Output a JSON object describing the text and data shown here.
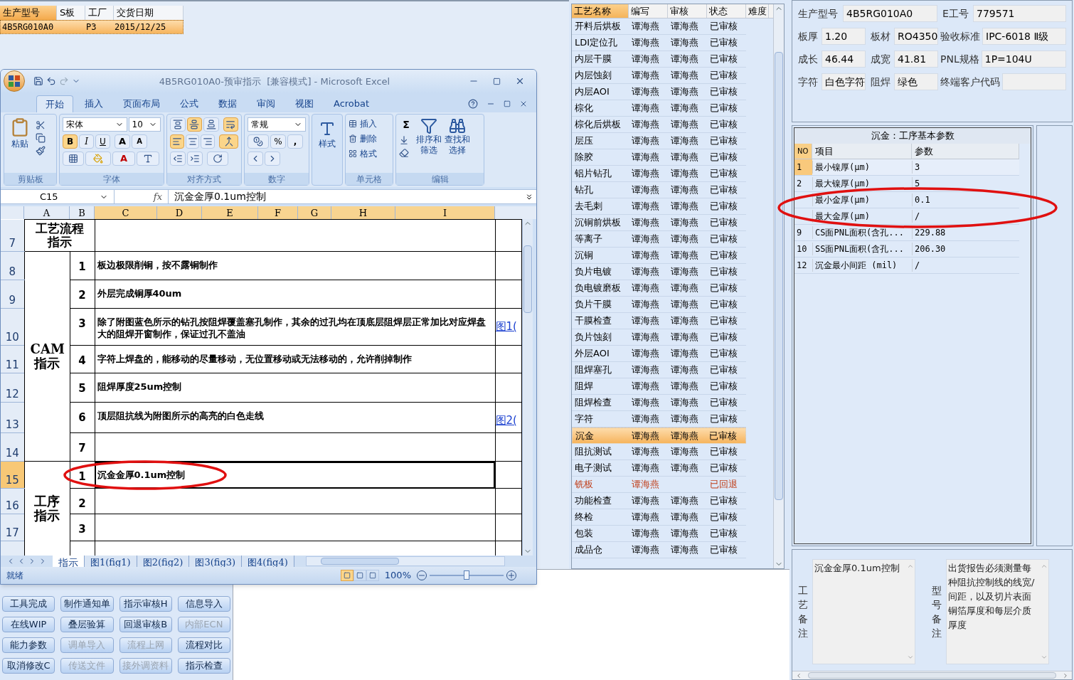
{
  "order_table": {
    "columns": [
      {
        "label": "生产型号",
        "selected": true
      },
      {
        "label": "S板",
        "selected": false
      },
      {
        "label": "工厂",
        "selected": false
      },
      {
        "label": "交货日期",
        "selected": false
      }
    ],
    "rows": [
      {
        "model": "4B5RG010A0",
        "factory": "P3",
        "delivery_date": "2015/12/25",
        "selected": true
      }
    ]
  },
  "excel": {
    "title": "4B5RG010A0-预审指示  [兼容模式] - Microsoft Excel",
    "tabs": [
      {
        "label": "开始",
        "selected": true
      },
      {
        "label": "插入",
        "selected": false
      },
      {
        "label": "页面布局",
        "selected": false
      },
      {
        "label": "公式",
        "selected": false
      },
      {
        "label": "数据",
        "selected": false
      },
      {
        "label": "审阅",
        "selected": false
      },
      {
        "label": "视图",
        "selected": false
      },
      {
        "label": "Acrobat",
        "selected": false
      }
    ],
    "ribbon": {
      "paste": "粘贴",
      "font_name": "宋体",
      "font_size": "10",
      "format_buttons": [
        {
          "label": "B",
          "on": true
        },
        {
          "label": "I",
          "on": false
        },
        {
          "label": "U",
          "on": false
        }
      ],
      "grow_font": "A",
      "shrink_font": "A",
      "font_color": "A",
      "vertical_align": [
        {
          "on": false
        },
        {
          "on": true
        },
        {
          "on": false
        }
      ],
      "horizontal_align": [
        {
          "on": true
        },
        {
          "on": false
        },
        {
          "on": false
        }
      ],
      "wrap_text": {
        "on": true
      },
      "merge": {
        "on": true
      },
      "number_format": "常规",
      "percent": "%",
      "comma": ",",
      "styles": "样式",
      "cell_buttons": [
        "插入",
        "删除",
        "格式"
      ],
      "sum": "Σ",
      "sort_filter": [
        "排序和",
        "筛选"
      ],
      "find_select": [
        "查找和",
        "选择"
      ],
      "group_labels": [
        "剪贴板",
        "字体",
        "对齐方式",
        "数字",
        "单元格",
        "编辑"
      ]
    },
    "name_box": "C15",
    "formula_label": "fx",
    "formula": "沉金金厚0.1um控制",
    "columns": [
      {
        "label": "A",
        "selected": false
      },
      {
        "label": "B",
        "selected": false
      },
      {
        "label": "C",
        "selected": true
      },
      {
        "label": "D",
        "selected": true
      },
      {
        "label": "E",
        "selected": true
      },
      {
        "label": "F",
        "selected": true
      },
      {
        "label": "G",
        "selected": true
      },
      {
        "label": "H",
        "selected": true
      },
      {
        "label": "I",
        "selected": true
      }
    ],
    "row_numbers": [
      {
        "label": "7",
        "selected": false
      },
      {
        "label": "8",
        "selected": false
      },
      {
        "label": "9",
        "selected": false
      },
      {
        "label": "10",
        "selected": false
      },
      {
        "label": "11",
        "selected": false
      },
      {
        "label": "12",
        "selected": false
      },
      {
        "label": "13",
        "selected": false
      },
      {
        "label": "14",
        "selected": false
      },
      {
        "label": "15",
        "selected": true
      },
      {
        "label": "16",
        "selected": false
      },
      {
        "label": "17",
        "selected": false
      }
    ],
    "title_cell": "工艺流程指示",
    "sections": [
      {
        "label": "CAM\n指示",
        "items": [
          {
            "no": "1",
            "text": "板边极限削铜，按不露铜制作"
          },
          {
            "no": "2",
            "text": "外层完成铜厚40um"
          },
          {
            "no": "3",
            "text": "除了附图蓝色所示的钻孔按阻焊覆盖塞孔制作，其余的过孔均在顶底层阻焊层正常加比对应焊盘大的阻焊开窗制作，保证过孔不盖油",
            "link": "图1("
          },
          {
            "no": "4",
            "text": "字符上焊盘的，能移动的尽量移动，无位置移动或无法移动的，允许削掉制作"
          },
          {
            "no": "5",
            "text": "阻焊厚度25um控制"
          },
          {
            "no": "6",
            "text": "顶层阻抗线为附图所示的高亮的白色走线",
            "link": "图2("
          },
          {
            "no": "7"
          }
        ]
      },
      {
        "label": "工序指示",
        "items": [
          {
            "no": "1",
            "text": "沉金金厚0.1um控制",
            "selected": true
          },
          {
            "no": "2"
          },
          {
            "no": "3"
          }
        ]
      }
    ],
    "sheet_tabs": [
      {
        "label": "指示",
        "selected": true
      },
      {
        "label": "图1(fig1)",
        "selected": false
      },
      {
        "label": "图2(fig2)",
        "selected": false
      },
      {
        "label": "图3(fig3)",
        "selected": false
      },
      {
        "label": "图4(fig4)",
        "selected": false
      }
    ],
    "status": "就绪",
    "views": [
      {
        "selected": true
      },
      {
        "selected": false
      },
      {
        "selected": false
      }
    ],
    "zoom": "100%",
    "zoom_slider": {
      "level": 0.5
    }
  },
  "process_list": {
    "columns": [
      "工艺名称",
      "编写",
      "审核",
      "状态",
      "难度"
    ],
    "rows": [
      {
        "name": "开料后烘板",
        "writer": "谭海燕",
        "reviewer": "谭海燕",
        "status": "已审核",
        "returned": false,
        "selected": false
      },
      {
        "name": "LDI定位孔",
        "writer": "谭海燕",
        "reviewer": "谭海燕",
        "status": "已审核",
        "returned": false,
        "selected": false
      },
      {
        "name": "内层干膜",
        "writer": "谭海燕",
        "reviewer": "谭海燕",
        "status": "已审核",
        "returned": false,
        "selected": false
      },
      {
        "name": "内层蚀刻",
        "writer": "谭海燕",
        "reviewer": "谭海燕",
        "status": "已审核",
        "returned": false,
        "selected": false
      },
      {
        "name": "内层AOI",
        "writer": "谭海燕",
        "reviewer": "谭海燕",
        "status": "已审核",
        "returned": false,
        "selected": false
      },
      {
        "name": "棕化",
        "writer": "谭海燕",
        "reviewer": "谭海燕",
        "status": "已审核",
        "returned": false,
        "selected": false
      },
      {
        "name": "棕化后烘板",
        "writer": "谭海燕",
        "reviewer": "谭海燕",
        "status": "已审核",
        "returned": false,
        "selected": false
      },
      {
        "name": "层压",
        "writer": "谭海燕",
        "reviewer": "谭海燕",
        "status": "已审核",
        "returned": false,
        "selected": false
      },
      {
        "name": "除胶",
        "writer": "谭海燕",
        "reviewer": "谭海燕",
        "status": "已审核",
        "returned": false,
        "selected": false
      },
      {
        "name": "铝片钻孔",
        "writer": "谭海燕",
        "reviewer": "谭海燕",
        "status": "已审核",
        "returned": false,
        "selected": false
      },
      {
        "name": "钻孔",
        "writer": "谭海燕",
        "reviewer": "谭海燕",
        "status": "已审核",
        "returned": false,
        "selected": false
      },
      {
        "name": "去毛刺",
        "writer": "谭海燕",
        "reviewer": "谭海燕",
        "status": "已审核",
        "returned": false,
        "selected": false
      },
      {
        "name": "沉铜前烘板",
        "writer": "谭海燕",
        "reviewer": "谭海燕",
        "status": "已审核",
        "returned": false,
        "selected": false
      },
      {
        "name": "等离子",
        "writer": "谭海燕",
        "reviewer": "谭海燕",
        "status": "已审核",
        "returned": false,
        "selected": false
      },
      {
        "name": "沉铜",
        "writer": "谭海燕",
        "reviewer": "谭海燕",
        "status": "已审核",
        "returned": false,
        "selected": false
      },
      {
        "name": "负片电镀",
        "writer": "谭海燕",
        "reviewer": "谭海燕",
        "status": "已审核",
        "returned": false,
        "selected": false
      },
      {
        "name": "负电镀磨板",
        "writer": "谭海燕",
        "reviewer": "谭海燕",
        "status": "已审核",
        "returned": false,
        "selected": false
      },
      {
        "name": "负片干膜",
        "writer": "谭海燕",
        "reviewer": "谭海燕",
        "status": "已审核",
        "returned": false,
        "selected": false
      },
      {
        "name": "干膜检查",
        "writer": "谭海燕",
        "reviewer": "谭海燕",
        "status": "已审核",
        "returned": false,
        "selected": false
      },
      {
        "name": "负片蚀刻",
        "writer": "谭海燕",
        "reviewer": "谭海燕",
        "status": "已审核",
        "returned": false,
        "selected": false
      },
      {
        "name": "外层AOI",
        "writer": "谭海燕",
        "reviewer": "谭海燕",
        "status": "已审核",
        "returned": false,
        "selected": false
      },
      {
        "name": "阻焊塞孔",
        "writer": "谭海燕",
        "reviewer": "谭海燕",
        "status": "已审核",
        "returned": false,
        "selected": false
      },
      {
        "name": "阻焊",
        "writer": "谭海燕",
        "reviewer": "谭海燕",
        "status": "已审核",
        "returned": false,
        "selected": false
      },
      {
        "name": "阻焊检查",
        "writer": "谭海燕",
        "reviewer": "谭海燕",
        "status": "已审核",
        "returned": false,
        "selected": false
      },
      {
        "name": "字符",
        "writer": "谭海燕",
        "reviewer": "谭海燕",
        "status": "已审核",
        "returned": false,
        "selected": false
      },
      {
        "name": "沉金",
        "writer": "谭海燕",
        "reviewer": "谭海燕",
        "status": "已审核",
        "returned": false,
        "selected": true
      },
      {
        "name": "阻抗测试",
        "writer": "谭海燕",
        "reviewer": "谭海燕",
        "status": "已审核",
        "returned": false,
        "selected": false
      },
      {
        "name": "电子测试",
        "writer": "谭海燕",
        "reviewer": "谭海燕",
        "status": "已审核",
        "returned": false,
        "selected": false
      },
      {
        "name": "铣板",
        "writer": "谭海燕",
        "status": "已回退",
        "returned": true,
        "selected": false
      },
      {
        "name": "功能检查",
        "writer": "谭海燕",
        "reviewer": "谭海燕",
        "status": "已审核",
        "returned": false,
        "selected": false
      },
      {
        "name": "终检",
        "writer": "谭海燕",
        "reviewer": "谭海燕",
        "status": "已审核",
        "returned": false,
        "selected": false
      },
      {
        "name": "包装",
        "writer": "谭海燕",
        "reviewer": "谭海燕",
        "status": "已审核",
        "returned": false,
        "selected": false
      },
      {
        "name": "成品仓",
        "writer": "谭海燕",
        "reviewer": "谭海燕",
        "status": "已审核",
        "returned": false,
        "selected": false
      }
    ]
  },
  "buttons": [
    {
      "label": "工具完成",
      "disabled": false
    },
    {
      "label": "制作通知单",
      "disabled": false
    },
    {
      "label": "指示审核H",
      "disabled": false
    },
    {
      "label": "信息导入",
      "disabled": false
    },
    {
      "label": "在线WIP",
      "disabled": false
    },
    {
      "label": "叠层验算",
      "disabled": false
    },
    {
      "label": "回退审核B",
      "disabled": false
    },
    {
      "label": "内部ECN",
      "disabled": true
    },
    {
      "label": "能力参数",
      "disabled": false
    },
    {
      "label": "调单导入",
      "disabled": true
    },
    {
      "label": "流程上网",
      "disabled": true
    },
    {
      "label": "流程对比",
      "disabled": false
    },
    {
      "label": "取消修改C",
      "disabled": false
    },
    {
      "label": "传送文件",
      "disabled": true
    },
    {
      "label": "接外调资料",
      "disabled": true
    },
    {
      "label": "指示检查",
      "disabled": false
    }
  ],
  "info": {
    "first_row": [
      {
        "label": "生产型号",
        "value": "4B5RG010A0"
      },
      {
        "label": "E工号",
        "value": "779571"
      }
    ],
    "rows": [
      [
        {
          "label": "板厚",
          "value": "1.20"
        },
        {
          "label": "板材",
          "value": "RO4350"
        },
        {
          "label": "验收标准",
          "value": "IPC-6018 Ⅱ级"
        }
      ],
      [
        {
          "label": "成长",
          "value": "46.44"
        },
        {
          "label": "成宽",
          "value": "41.81"
        },
        {
          "label": "PNL规格",
          "value": "1P=104U"
        }
      ],
      [
        {
          "label": "字符",
          "value": "白色字符"
        },
        {
          "label": "阻焊",
          "value": "绿色"
        },
        {
          "label": "终端客户代码"
        }
      ]
    ]
  },
  "params": {
    "title": "沉金：工序基本参数",
    "columns": [
      "NO",
      "项目",
      "参数"
    ],
    "rows": [
      {
        "no": "1",
        "item": "最小镍厚(μm)",
        "value": "3",
        "selected": true
      },
      {
        "no": "2",
        "item": "最大镍厚(μm)",
        "value": "5",
        "selected": false
      },
      {
        "item": "最小金厚(μm)",
        "value": "0.1",
        "selected": false
      },
      {
        "item": "最大金厚(μm)",
        "value": "/",
        "selected": false
      },
      {
        "no": "9",
        "item": "CS面PNL面积(含孔...",
        "value": "229.88",
        "selected": false
      },
      {
        "no": "10",
        "item": "SS面PNL面积(含孔...",
        "value": "206.30",
        "selected": false
      },
      {
        "no": "12",
        "item": "沉金最小间距 (mil)",
        "value": "/",
        "selected": false
      }
    ]
  },
  "notes": [
    {
      "label": "工艺备注",
      "text": "沉金金厚0.1um控制"
    },
    {
      "label": "型号备注",
      "text": "出货报告必须测量每种阻抗控制线的线宽/间距，以及切片表面铜箔厚度和每层介质厚度"
    }
  ]
}
